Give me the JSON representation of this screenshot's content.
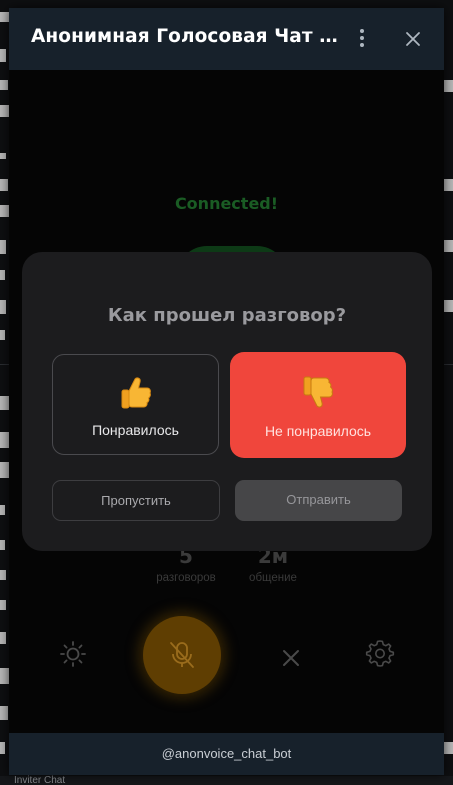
{
  "window": {
    "title": "Анонимная Голосовая Чат Рулетка",
    "menu_icon": "kebab-menu-icon",
    "close_icon": "close-icon"
  },
  "call": {
    "status": "Connected!",
    "stats": [
      {
        "value": "5",
        "label": "разговоров"
      },
      {
        "value": "2м",
        "label": "общение"
      }
    ],
    "controls": {
      "theme_icon": "sun-icon",
      "mic_icon": "microphone-muted-icon",
      "end_icon": "close-icon",
      "settings_icon": "gear-icon"
    },
    "colors": {
      "status": "#1a5c24",
      "mic": "#5f3e02"
    }
  },
  "rating_modal": {
    "title": "Как прошел разговор?",
    "like": {
      "emoji": "👍",
      "label": "Понравилось",
      "selected": false
    },
    "dislike": {
      "emoji": "👎",
      "label": "Не понравилось",
      "selected": true,
      "color": "#f0463c"
    },
    "skip_label": "Пропустить",
    "send_label": "Отправить"
  },
  "footer": {
    "handle": "@anonvoice_chat_bot"
  },
  "background_page": {
    "footer_text": "Inviter Chat"
  }
}
